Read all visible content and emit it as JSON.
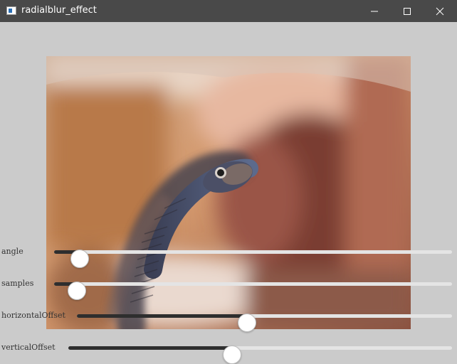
{
  "window": {
    "title": "radialblur_effect",
    "icon": "app-window-icon",
    "controls": {
      "minimize_icon": "minimize-icon",
      "maximize_icon": "maximize-icon",
      "close_icon": "close-icon"
    }
  },
  "canvas": {
    "subject": "radially blurred snake photo"
  },
  "sliders": [
    {
      "id": "angle",
      "label": "angle",
      "value_fraction": 0.065
    },
    {
      "id": "samples",
      "label": "samples",
      "value_fraction": 0.058
    },
    {
      "id": "horizontalOffset",
      "label": "horizontalOffset",
      "value_fraction": 0.453
    },
    {
      "id": "verticalOffset",
      "label": "verticalOffset",
      "value_fraction": 0.426
    }
  ],
  "colors": {
    "titlebar": "#494949",
    "background": "#cbcbcb",
    "track": "#e4e4e4",
    "track_fill": "#2e2e2e",
    "thumb": "#ffffff"
  }
}
